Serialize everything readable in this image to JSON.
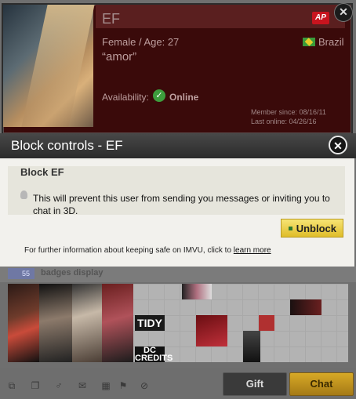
{
  "profile": {
    "name": "EF",
    "ap_badge": "AP",
    "gender_age": "Female   / Age: 27",
    "quote": "“amor”",
    "country": "Brazil",
    "availability_label": "Availability:",
    "availability_status": "Online",
    "member_since": "Member since: 08/16/11",
    "last_online": "Last online: 04/26/16"
  },
  "dialog": {
    "title": "Block controls - EF",
    "heading": "Block EF",
    "message": "This will prevent this user from sending you messages or inviting you to chat in 3D.",
    "unblock_label": "Unblock",
    "footer_text": "For further information about keeping safe on IMVU, click to ",
    "footer_link": "learn more"
  },
  "badges": {
    "count": "55",
    "label": "badges display",
    "tidy_text": "TIDY",
    "dc_text": "DC CREDITS"
  },
  "actions": {
    "gift_label": "Gift",
    "chat_label": "Chat"
  },
  "icons": {
    "close": "close-icon",
    "check": "check-icon",
    "bulb": "lightbulb-icon"
  },
  "colors": {
    "profile_bg": "#3a0a0a",
    "unblock_bg": "#f1d64e",
    "chat_bg": "#c1921e"
  }
}
